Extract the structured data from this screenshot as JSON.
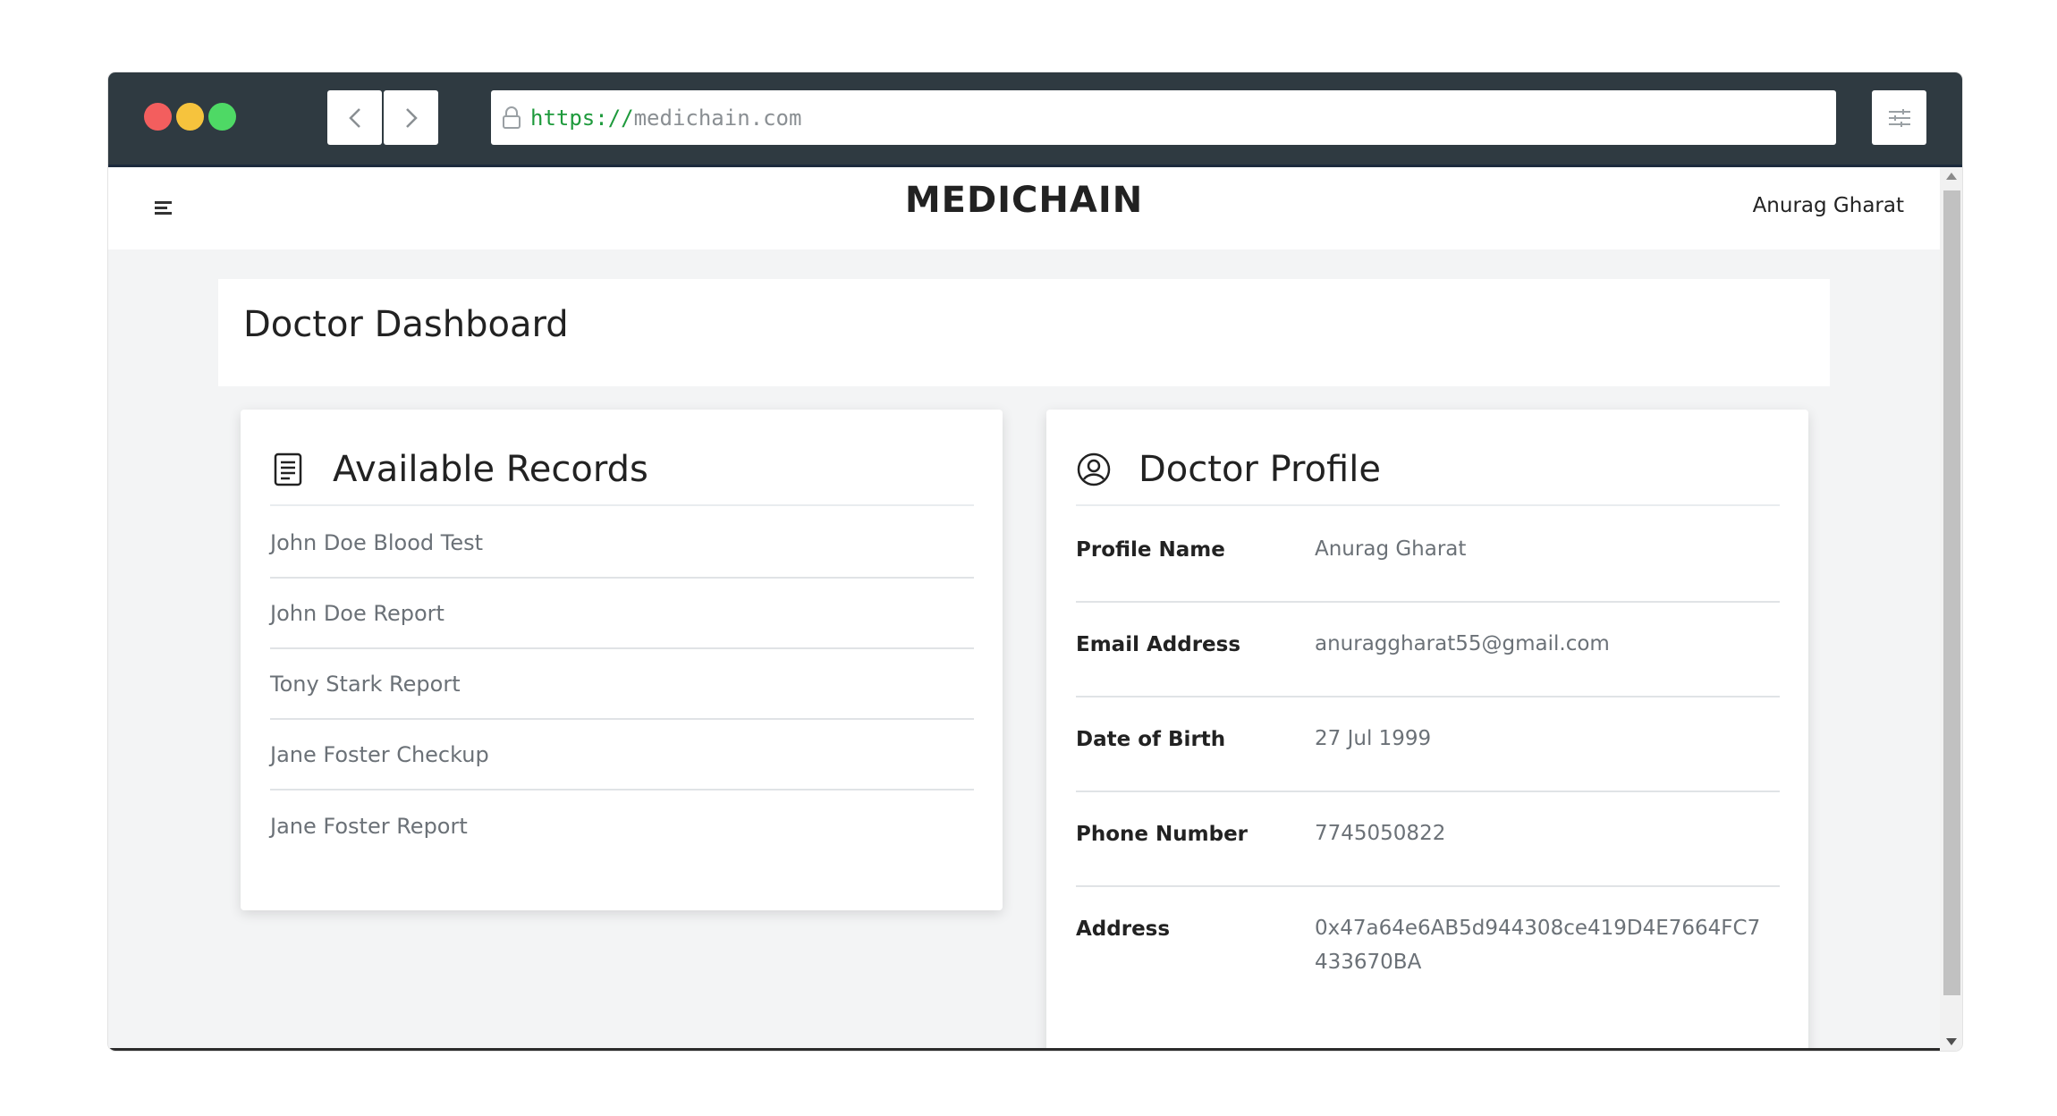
{
  "browser": {
    "url_scheme": "https://",
    "url_host": "medichain.com"
  },
  "app": {
    "brand": "MEDICHAIN",
    "user_name": "Anurag Gharat"
  },
  "dashboard": {
    "title": "Doctor Dashboard"
  },
  "records": {
    "title": "Available Records",
    "items": [
      "John Doe Blood Test",
      "John Doe Report",
      "Tony Stark Report",
      "Jane Foster Checkup",
      "Jane Foster Report"
    ]
  },
  "profile": {
    "title": "Doctor Profile",
    "rows": [
      {
        "label": "Profile Name",
        "value": "Anurag Gharat"
      },
      {
        "label": "Email Address",
        "value": "anuraggharat55@gmail.com"
      },
      {
        "label": "Date of Birth",
        "value": "27 Jul 1999"
      },
      {
        "label": "Phone Number",
        "value": "7745050822"
      },
      {
        "label": "Address",
        "value": "0x47a64e6AB5d944308ce419D4E7664FC7433670BA"
      }
    ]
  },
  "icons": {
    "records": "document-icon",
    "profile": "user-circle-icon"
  }
}
